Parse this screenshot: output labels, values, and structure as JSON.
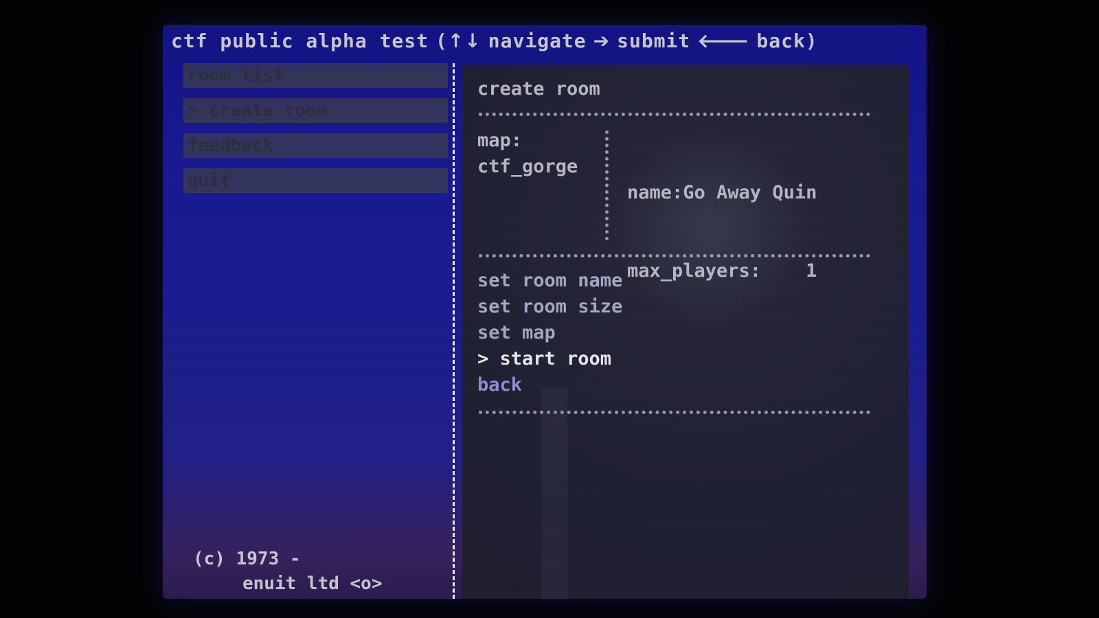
{
  "title_bar": {
    "title": "ctf public alpha test",
    "hint_open": "(",
    "up_down_arrows": "↑↓",
    "navigate_label": "navigate",
    "right_arrow": "➔",
    "submit_label": "submit",
    "left_arrow": "🡐",
    "back_label": "back)"
  },
  "left_menu": {
    "items": [
      {
        "label": "room list"
      },
      {
        "label": "> create room"
      },
      {
        "label": "feedback"
      },
      {
        "label": "quit"
      }
    ]
  },
  "copyright": {
    "line1": "(c) 1973 -",
    "line2": "enuit ltd <o>"
  },
  "create_room_panel": {
    "title": "create room",
    "map_label": "map:",
    "map_value": "ctf_gorge",
    "name_line": "name:Go Away Quin",
    "max_players_line": "max_players:    1",
    "actions": [
      {
        "label": "set room name"
      },
      {
        "label": "set room size"
      },
      {
        "label": "set map"
      },
      {
        "label": "> start room"
      },
      {
        "label": "back"
      }
    ]
  },
  "colors": {
    "screen_blue": "#1a1a92",
    "panel_bg": "#212134",
    "text_light": "#c8c8d2",
    "selected_text": "#e8e8f0",
    "back_link": "#8f8fd6"
  }
}
